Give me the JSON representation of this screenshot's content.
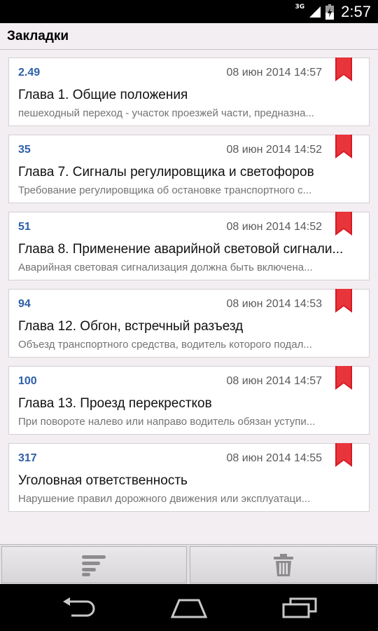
{
  "status_bar": {
    "network": "3G",
    "time": "2:57"
  },
  "title_bar": {
    "title": "Закладки"
  },
  "bookmarks": [
    {
      "number": "2.49",
      "date": "08 июн 2014 14:57",
      "chapter": "Глава 1. Общие положения",
      "snippet": "пешеходный переход - участок проезжей части, предназна..."
    },
    {
      "number": "35",
      "date": "08 июн 2014 14:52",
      "chapter": "Глава 7. Сигналы регулировщика и светофоров",
      "snippet": "Требование регулировщика об остановке транспортного с..."
    },
    {
      "number": "51",
      "date": "08 июн 2014 14:52",
      "chapter": "Глава 8. Применение аварийной световой сигнали...",
      "snippet": "Аварийная световая сигнализация должна быть включена..."
    },
    {
      "number": "94",
      "date": "08 июн 2014 14:53",
      "chapter": "Глава 12. Обгон, встречный разъезд",
      "snippet": "Объезд транспортного средства, водитель которого подал..."
    },
    {
      "number": "100",
      "date": "08 июн 2014 14:57",
      "chapter": "Глава 13. Проезд перекрестков",
      "snippet": "При повороте налево или направо водитель обязан уступи..."
    },
    {
      "number": "317",
      "date": "08 июн 2014 14:55",
      "chapter": "Уголовная ответственность",
      "snippet": "Нарушение правил дорожного движения или эксплуатаци..."
    }
  ],
  "bottom_bar": {
    "left_icon": "sort-icon",
    "right_icon": "trash-icon"
  },
  "nav_bar": {
    "icons": [
      "back-icon",
      "home-icon",
      "recent-apps-icon"
    ]
  },
  "colors": {
    "accent_number": "#2d5fa8",
    "ribbon": "#d41a24",
    "background": "#f2eef2"
  }
}
